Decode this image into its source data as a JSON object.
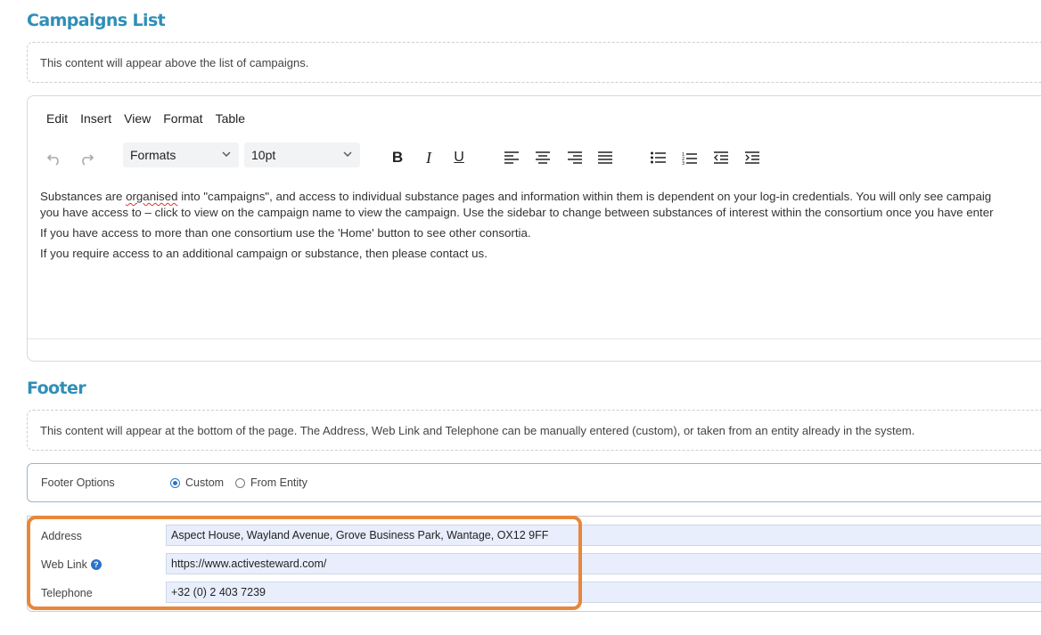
{
  "campaigns": {
    "title": "Campaigns List",
    "hint": "This content will appear above the list of campaigns."
  },
  "editor": {
    "menu": [
      "Edit",
      "Insert",
      "View",
      "Format",
      "Table"
    ],
    "formats_select": "Formats",
    "size_select": "10pt",
    "icons": [
      "undo-icon",
      "redo-icon",
      "bold-icon",
      "italic-icon",
      "underline-icon",
      "align-left-icon",
      "align-center-icon",
      "align-right-icon",
      "align-justify-icon",
      "bullet-list-icon",
      "numbered-list-icon",
      "outdent-icon",
      "indent-icon"
    ],
    "para1_pre": "Substances are ",
    "para1_misspelled": "organised",
    "para1_post": " into \"campaigns\", and access to individual substance pages and information within them is dependent on your log-in credentials. You will only see campaig",
    "para1_line2": "you have access to – click to view on the campaign name to view the campaign. Use the sidebar to change between substances of interest within the consortium once you have enter",
    "para2": "If you have access to more than one consortium use the 'Home' button to see other consortia.",
    "para3": "If you require access to an additional campaign or substance, then please contact us."
  },
  "footer": {
    "title": "Footer",
    "hint": "This content will appear at the bottom of the page. The Address, Web Link and Telephone can be manually entered (custom), or taken from an entity already in the system.",
    "options_label": "Footer Options",
    "option_custom": "Custom",
    "option_entity": "From Entity",
    "selected_option": "Custom",
    "address_label": "Address",
    "address_value": "Aspect House, Wayland Avenue, Grove Business Park, Wantage, OX12 9FF",
    "weblink_label": "Web Link",
    "weblink_value": "https://www.activesteward.com/",
    "telephone_label": "Telephone",
    "telephone_value": "+32 (0) 2 403 7239"
  },
  "colors": {
    "title": "#2f8fb8",
    "highlight": "#e8873a",
    "radio": "#2a73c8",
    "input_bg": "#e8eefc"
  }
}
